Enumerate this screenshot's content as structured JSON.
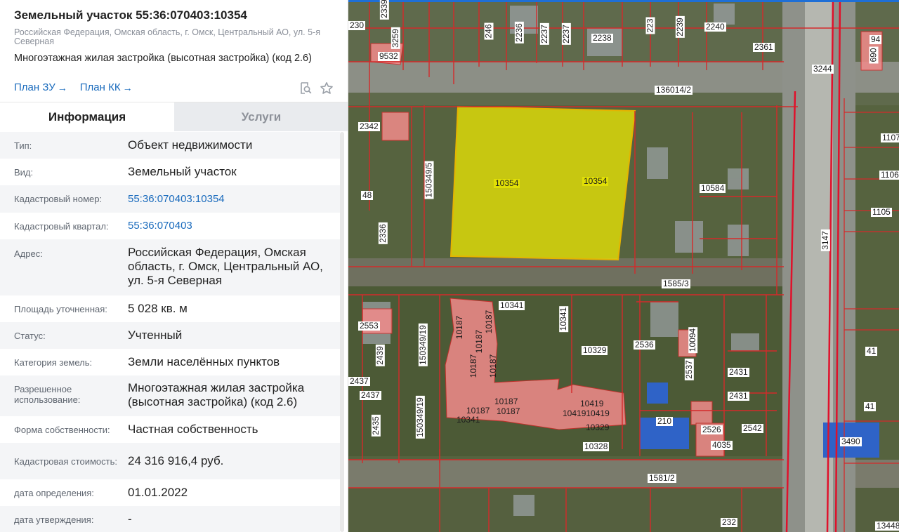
{
  "colors": {
    "accent": "#1a6bbd",
    "parcel_border": "#d42a2a",
    "selected_fill": "#f2ee00",
    "parcel_fill": "#f28b8b",
    "top_bar": "#1e6fd6"
  },
  "header": {
    "title": "Земельный участок 55:36:070403:10354",
    "address": "Российская Федерация, Омская область, г. Омск, Центральный АО, ул. 5-я Северная",
    "usage": "Многоэтажная жилая застройка (высотная застройка) (код 2.6)"
  },
  "links": [
    {
      "label": "План ЗУ",
      "arrow": "→"
    },
    {
      "label": "План КК",
      "arrow": "→"
    }
  ],
  "icons": {
    "search_doc": "search-document-icon",
    "favorite": "star-icon"
  },
  "tabs": [
    {
      "label": "Информация",
      "active": true
    },
    {
      "label": "Услуги",
      "active": false
    }
  ],
  "info": [
    {
      "label": "Тип:",
      "value": "Объект недвижимости"
    },
    {
      "label": "Вид:",
      "value": "Земельный участок"
    },
    {
      "label": "Кадастровый номер:",
      "value": "55:36:070403:10354",
      "link": true
    },
    {
      "label": "Кадастровый квартал:",
      "value": "55:36:070403",
      "link": true
    },
    {
      "label": "Адрес:",
      "value": "Российская Федерация, Омская область, г. Омск, Центральный АО, ул. 5-я Северная"
    },
    {
      "label": "Площадь уточненная:",
      "value": "5 028 кв. м"
    },
    {
      "label": "Статус:",
      "value": "Учтенный"
    },
    {
      "label": "Категория земель:",
      "value": "Земли населённых пунктов"
    },
    {
      "label": "Разрешенное использование:",
      "value": "Многоэтажная жилая застройка (высотная застройка) (код 2.6)"
    },
    {
      "label": "Форма собственности:",
      "value": "Частная собственность"
    },
    {
      "label": "Кадастровая стоимость:",
      "value": "24 316 916,4 руб."
    },
    {
      "label": "дата определения:",
      "value": "01.01.2022"
    },
    {
      "label": "дата утверждения:",
      "value": "-"
    }
  ],
  "map": {
    "selected_labels": [
      "10354",
      "10354"
    ],
    "parcel_labels": [
      "2339",
      "230",
      "3259",
      "9532",
      "246",
      "2236",
      "2237",
      "2237",
      "2238",
      "223",
      "2239",
      "2240",
      "2361",
      "94",
      "690",
      "3244",
      "136014/2",
      "2342",
      "150349/5",
      "48",
      "2336",
      "10584",
      "1107",
      "1106",
      "1105",
      "3147",
      "1585/3",
      "10341",
      "10341",
      "2553",
      "2439",
      "2437",
      "2437",
      "2435",
      "150349/19",
      "150349/19",
      "10187",
      "10187",
      "10187",
      "10187",
      "10187",
      "10187",
      "10187",
      "10187",
      "10341",
      "10419",
      "1041910419",
      "10329",
      "10328",
      "10329",
      "2536",
      "10094",
      "2537",
      "2431",
      "2431",
      "210",
      "2526",
      "4035",
      "2542",
      "41",
      "41",
      "3490",
      "1581/2",
      "232",
      "13448"
    ]
  }
}
